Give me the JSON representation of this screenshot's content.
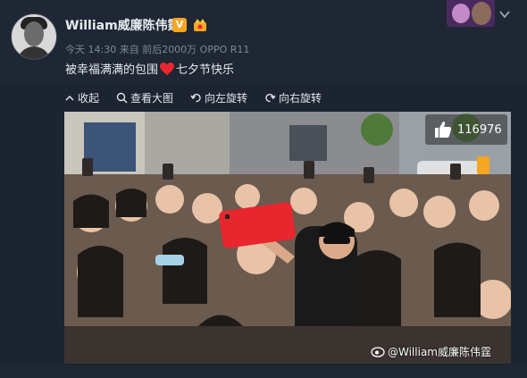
{
  "post": {
    "username": "William威廉陈伟霆",
    "verified_label": "V",
    "meta": "今天 14:30 来自 前后2000万 OPPO R11",
    "text_before": "被幸福满满的包围",
    "text_after": "七夕节快乐"
  },
  "toolbar": {
    "collect": "收起",
    "view_large": "查看大图",
    "rotate_left": "向左旋转",
    "rotate_right": "向右旋转"
  },
  "photo": {
    "like_count": "116976",
    "watermark": "@William威廉陈伟霆"
  },
  "colors": {
    "background": "#1b2430",
    "accent_red": "#e8262e",
    "verified": "#f5a623"
  },
  "icons": [
    "heart-icon",
    "crown-icon",
    "thumbs-up-icon",
    "weibo-eye-icon",
    "chevron-down-icon",
    "collapse-icon",
    "search-icon",
    "rotate-left-icon",
    "rotate-right-icon"
  ]
}
